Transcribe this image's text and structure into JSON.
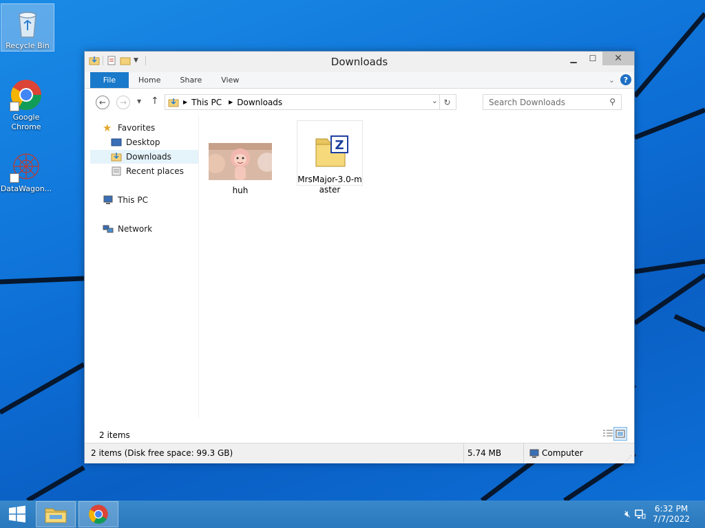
{
  "desktop": {
    "icons": [
      {
        "label": "Recycle Bin"
      },
      {
        "label": "Google Chrome"
      },
      {
        "label": "DataWagon..."
      }
    ]
  },
  "window": {
    "title": "Downloads",
    "ribbon_tabs": [
      "File",
      "Home",
      "Share",
      "View"
    ],
    "address": {
      "crumbs": [
        "This PC",
        "Downloads"
      ]
    },
    "search_placeholder": "Search Downloads",
    "nav": {
      "favorites": "Favorites",
      "desktop": "Desktop",
      "downloads": "Downloads",
      "recent": "Recent places",
      "this_pc": "This PC",
      "network": "Network"
    },
    "files": [
      {
        "name": "huh"
      },
      {
        "name": "MrsMajor-3.0-master"
      }
    ],
    "status": {
      "count": "2 items"
    },
    "details": {
      "summary": "2 items (Disk free space: 99.3 GB)",
      "size": "5.74 MB",
      "location": "Computer"
    }
  },
  "taskbar": {
    "time": "6:32 PM",
    "date": "7/7/2022"
  },
  "colors": {
    "file_tab": "#1979ca",
    "desktop_blue": "#0d6fd6",
    "taskbar": "#2d7fc4"
  }
}
